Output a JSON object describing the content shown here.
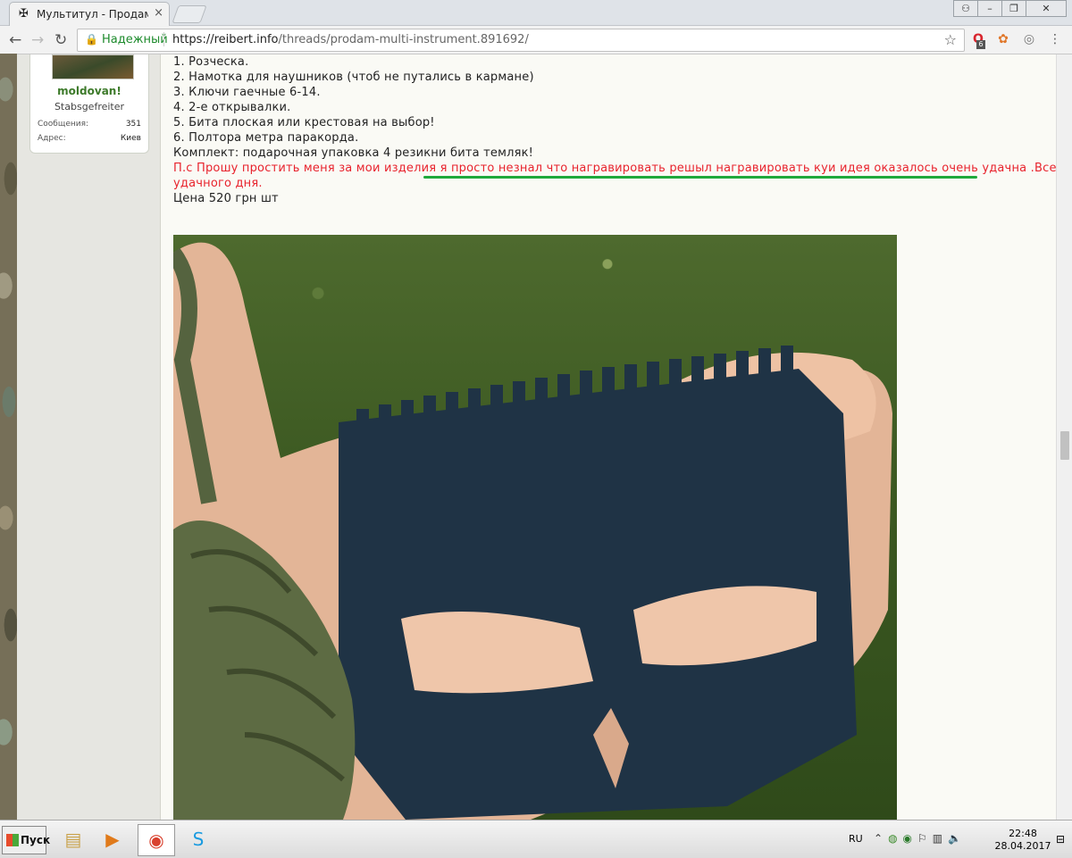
{
  "browser": {
    "tab_title": "Мультитул - Продам му",
    "secure_label": "Надежный",
    "url_host": "https://reibert.info",
    "url_path": "/threads/prodam-multi-instrument.891692/",
    "ext_badge": "6"
  },
  "user": {
    "name": "moldovan!",
    "rank": "Stabsgefreiter",
    "messages_label": "Сообщения:",
    "messages_value": "351",
    "address_label": "Адрес:",
    "address_value": "Киев"
  },
  "post": {
    "lines": [
      "1. Розческа.",
      "2. Намотка для наушников (чтоб не путались в кармане)",
      "3. Ключи гаечные 6-14.",
      "4. 2-е открывалки.",
      "5. Бита плоская или крестовая на выбор!",
      "6. Полтора метра паракорда.",
      "Комплект: подарочная упаковка 4 резикни бита темляк!"
    ],
    "red_line1": "П.с Прошу простить меня за мои изделия я просто незнал что награвировать решыл награвировать куи идея оказалось очень удачна .Всем",
    "red_line2": "удачного дня.",
    "price": "Цена 520 грн шт"
  },
  "taskbar": {
    "start_label": "Пуск",
    "lang": "RU",
    "time": "22:48",
    "date": "28.04.2017"
  }
}
